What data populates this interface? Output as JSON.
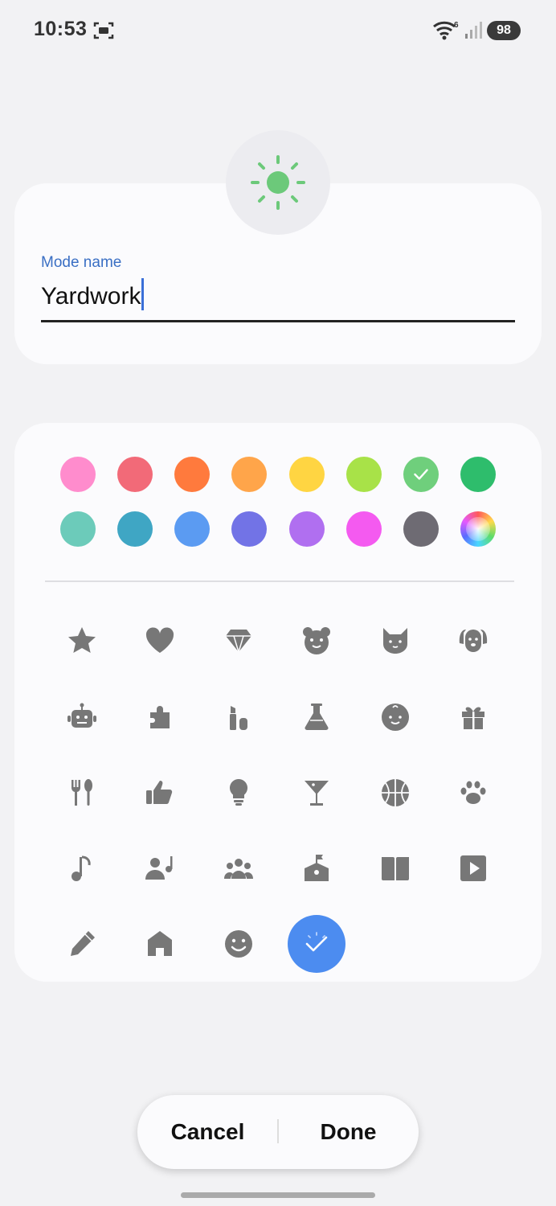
{
  "status_bar": {
    "time": "10:53",
    "wifi_label": "6",
    "battery": "98",
    "icons": [
      "screenshot-icon",
      "wifi-icon",
      "signal-icon",
      "battery-icon"
    ]
  },
  "mode_icon": {
    "name": "sun-icon",
    "color": "#6cc97a"
  },
  "name_field": {
    "label": "Mode name",
    "value": "Yardwork"
  },
  "colors": {
    "row1": [
      "#ff8ccd",
      "#f26a78",
      "#ff7a3d",
      "#ffa54a",
      "#ffd542",
      "#a8e248",
      "#6fcf7c",
      "#2ebd6c"
    ],
    "row2": [
      "#6ccbba",
      "#3fa6c4",
      "#5b9bf2",
      "#7273e6",
      "#b06ff0",
      "#f45af0",
      "#6e6b73",
      "multicolor"
    ],
    "selected": "#6fcf7c"
  },
  "icons": [
    [
      "star-icon",
      "heart-icon",
      "diamond-icon",
      "bear-icon",
      "cat-icon",
      "dog-icon"
    ],
    [
      "robot-icon",
      "puzzle-icon",
      "cosmetics-icon",
      "flask-icon",
      "baby-icon",
      "gift-icon"
    ],
    [
      "fork-spoon-icon",
      "thumbs-up-icon",
      "lightbulb-icon",
      "cocktail-icon",
      "basketball-icon",
      "paw-icon"
    ],
    [
      "music-note-icon",
      "user-music-icon",
      "group-icon",
      "school-icon",
      "book-icon",
      "play-icon"
    ],
    [
      "pencil-icon",
      "home-icon",
      "smile-icon",
      "selected-sun-icon"
    ]
  ],
  "buttons": {
    "cancel": "Cancel",
    "done": "Done"
  }
}
